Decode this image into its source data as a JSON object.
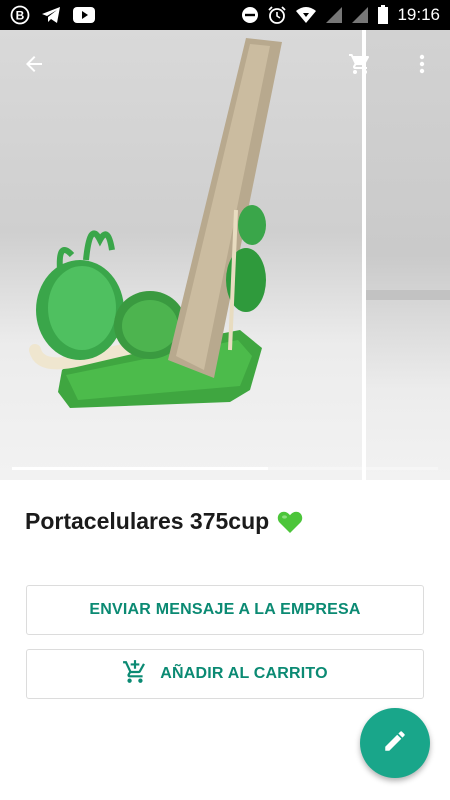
{
  "status_bar": {
    "time": "19:16",
    "left_icons": [
      "bolt-b-icon",
      "telegram-icon",
      "youtube-icon"
    ],
    "right_icons": [
      "do-not-disturb-icon",
      "alarm-icon",
      "wifi-icon",
      "signal-icon",
      "signal-icon",
      "battery-icon"
    ]
  },
  "header": {
    "back_icon": "arrow-left-icon",
    "cart_icon": "cart-icon",
    "menu_icon": "more-vert-icon"
  },
  "gallery": {
    "progress": 0.6
  },
  "product": {
    "title": "Portacelulares 375cup",
    "emoji_icon": "green-heart-icon"
  },
  "actions": {
    "message_label": "ENVIAR MENSAJE A LA EMPRESA",
    "cart_label": "AÑADIR AL CARRITO",
    "cart_icon": "add-to-cart-icon"
  },
  "fab": {
    "icon": "pencil-icon"
  },
  "colors": {
    "accent": "#0b8a73",
    "fab": "#19a68a",
    "heart": "#4cc53a",
    "status_bar": "#000000"
  }
}
